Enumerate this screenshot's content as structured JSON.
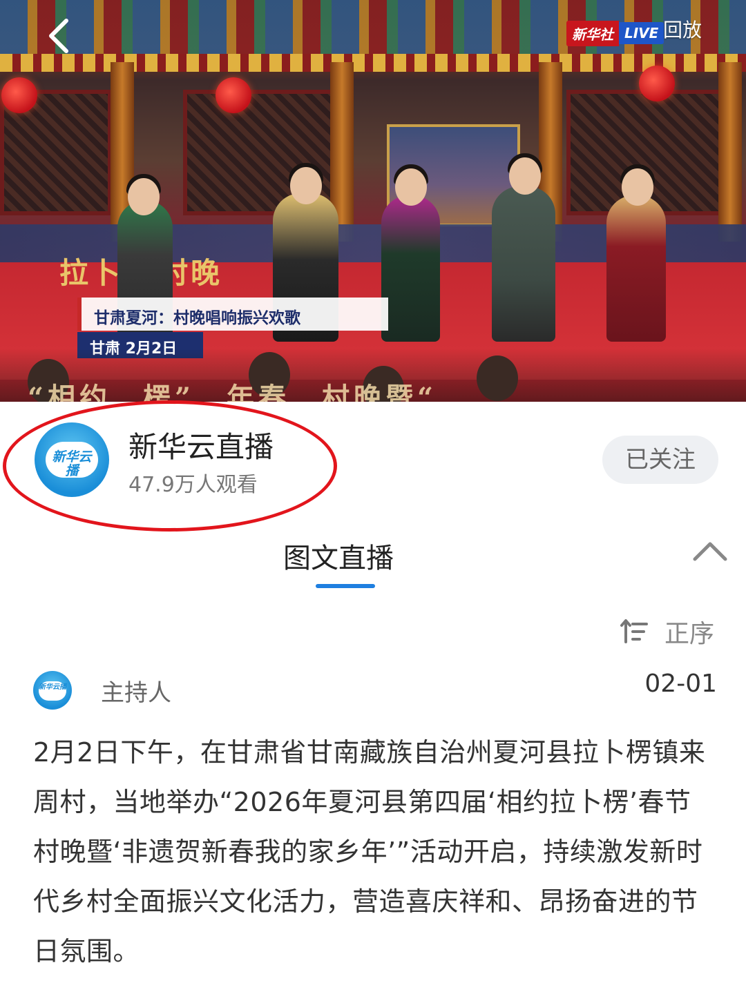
{
  "video": {
    "caption_title": "甘肃夏河：村晚唱响振兴欢歌",
    "caption_place_date": "甘肃  2月2日",
    "live_logo_text": "新华社",
    "live_badge": "LIVE",
    "replay_label": "回放",
    "back_icon": "chevron-left-icon",
    "stage_text_left": "拉卜",
    "stage_text_left2": "村晚",
    "banner_text": "“相约…楞”…年春…村晚暨“…"
  },
  "channel": {
    "avatar_text": "新华云播",
    "name": "新华云直播",
    "viewers": "47.9万人观看",
    "follow_label": "已关注",
    "annotation_color": "#e2151c"
  },
  "tab": {
    "label": "图文直播",
    "accent_color": "#1e7fe0",
    "collapse_icon": "chevron-up-icon"
  },
  "sort": {
    "icon": "sort-ascending-icon",
    "label": "正序"
  },
  "post": {
    "author": "主持人",
    "date": "02-01",
    "body": "2月2日下午，在甘肃省甘南藏族自治州夏河县拉卜楞镇来周村，当地举办“2026年夏河县第四届‘相约拉卜楞’春节村晚暨‘非遗贺新春我的家乡年’”活动开启，持续激发新时代乡村全面振兴文化活力，营造喜庆祥和、昂扬奋进的节日氛围。"
  }
}
